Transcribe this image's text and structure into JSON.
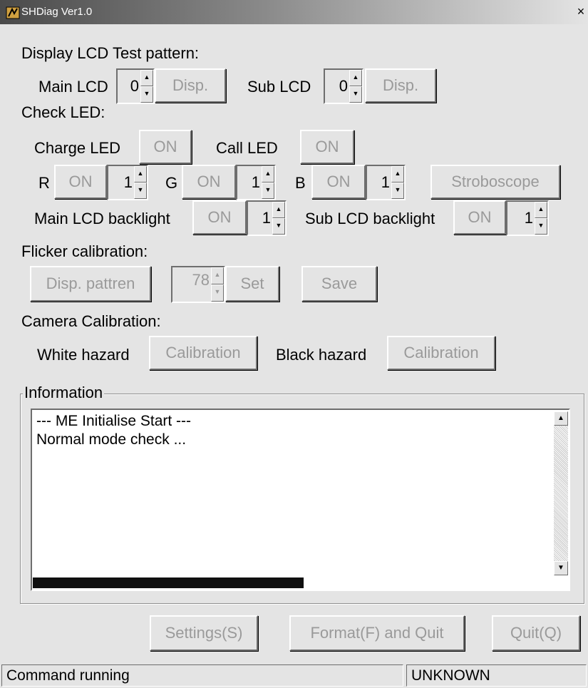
{
  "window": {
    "title": "SHDiag Ver1.0",
    "close": "×"
  },
  "lcd": {
    "heading": "Display LCD Test pattern:",
    "main_label": "Main LCD",
    "main_value": "0",
    "main_disp": "Disp.",
    "sub_label": "Sub LCD",
    "sub_value": "0",
    "sub_disp": "Disp."
  },
  "led": {
    "heading": "Check LED:",
    "charge_label": "Charge LED",
    "charge_on": "ON",
    "call_label": "Call LED",
    "call_on": "ON",
    "r_label": "R",
    "r_on": "ON",
    "r_value": "1",
    "g_label": "G",
    "g_on": "ON",
    "g_value": "1",
    "b_label": "B",
    "b_on": "ON",
    "b_value": "1",
    "stroboscope": "Stroboscope",
    "main_backlight_label": "Main LCD backlight",
    "main_backlight_on": "ON",
    "main_backlight_value": "1",
    "sub_backlight_label": "Sub LCD backlight",
    "sub_backlight_on": "ON",
    "sub_backlight_value": "1"
  },
  "flicker": {
    "heading": "Flicker calibration:",
    "disp_pattern": "Disp. pattren",
    "value": "78",
    "set": "Set",
    "save": "Save"
  },
  "camera": {
    "heading": "Camera Calibration:",
    "white_label": "White hazard",
    "white_button": "Calibration",
    "black_label": "Black hazard",
    "black_button": "Calibration"
  },
  "information": {
    "label": "Information",
    "lines": [
      "--- ME Initialise Start ---",
      "Normal mode check ..."
    ],
    "progress_fraction": 0.52
  },
  "footer": {
    "settings": "Settings(S)",
    "format_quit": "Format(F) and Quit",
    "quit": "Quit(Q)"
  },
  "status": {
    "left": "Command running",
    "right": "UNKNOWN"
  }
}
